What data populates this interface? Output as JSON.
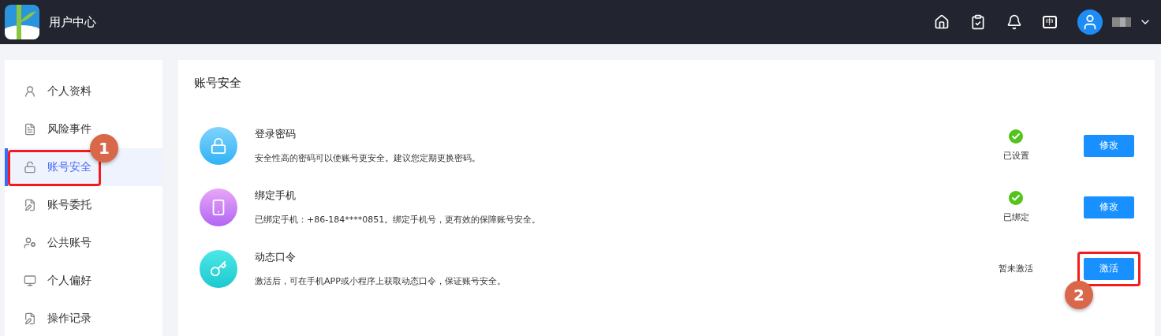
{
  "header": {
    "title": "用户中心",
    "language_label": "中"
  },
  "sidebar": {
    "items": [
      {
        "label": "个人资料",
        "kind": "profile",
        "selected": false
      },
      {
        "label": "风险事件",
        "kind": "risk",
        "selected": false
      },
      {
        "label": "账号安全",
        "kind": "security",
        "selected": true,
        "callout": "1"
      },
      {
        "label": "账号委托",
        "kind": "delegate",
        "selected": false
      },
      {
        "label": "公共账号",
        "kind": "public",
        "selected": false
      },
      {
        "label": "个人偏好",
        "kind": "preference",
        "selected": false
      },
      {
        "label": "操作记录",
        "kind": "log",
        "selected": false
      }
    ]
  },
  "main": {
    "heading": "账号安全",
    "items": [
      {
        "kind": "password",
        "title": "登录密码",
        "description": "安全性高的密码可以使账号更安全。建议您定期更换密码。",
        "done": true,
        "status": "已设置",
        "action": "修改"
      },
      {
        "kind": "phone",
        "title": "绑定手机",
        "description": "已绑定手机：+86-184****0851。绑定手机号，更有效的保障账号安全。",
        "done": true,
        "status": "已绑定",
        "action": "修改"
      },
      {
        "kind": "token",
        "title": "动态口令",
        "description": "激活后，可在手机APP或小程序上获取动态口令，保证账号安全。",
        "done": false,
        "status": "暂未激活",
        "action": "激活",
        "callout": "2"
      }
    ]
  }
}
